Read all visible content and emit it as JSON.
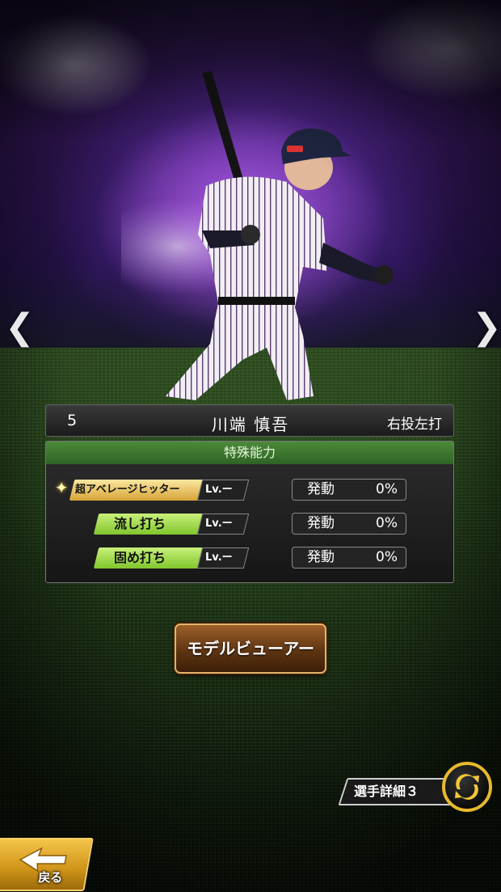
{
  "player": {
    "number": "5",
    "name": "川端 慎吾",
    "handedness": "右投左打"
  },
  "abilities_panel": {
    "title": "特殊能力",
    "rows": [
      {
        "name": "超アベレージヒッター",
        "badge": "超",
        "level": "Lv.ー",
        "status": "発動",
        "percent": "0%",
        "tier": "gold"
      },
      {
        "name": "流し打ち",
        "level": "Lv.ー",
        "status": "発動",
        "percent": "0%",
        "tier": "green"
      },
      {
        "name": "固め打ち",
        "level": "Lv.ー",
        "status": "発動",
        "percent": "0%",
        "tier": "green"
      }
    ]
  },
  "navigation": {
    "prev_icon": "chevron-left-icon",
    "next_icon": "chevron-right-icon",
    "prev_glyph": "❮",
    "next_glyph": "❯"
  },
  "buttons": {
    "model_viewer": "モデルビューアー",
    "player_details": "選手詳細３",
    "back": "戻る"
  },
  "colors": {
    "ability_green": "#9fdc4a",
    "ability_gold": "#e7bd55",
    "accent_gold": "#e7b92c",
    "button_brown": "#6b3e17"
  }
}
